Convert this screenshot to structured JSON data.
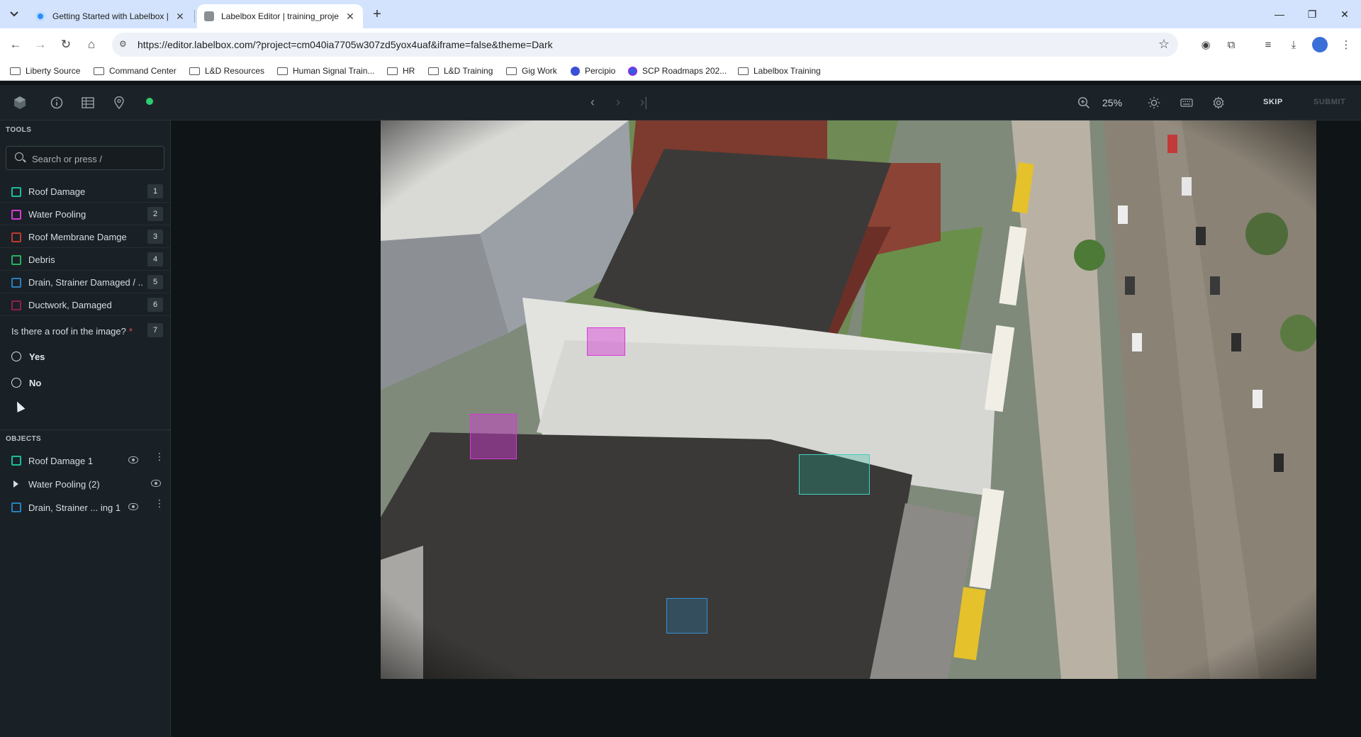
{
  "browser": {
    "tabs": [
      {
        "title": "Getting Started with Labelbox |",
        "active": false
      },
      {
        "title": "Labelbox Editor | training_proje",
        "active": true
      }
    ],
    "url": "https://editor.labelbox.com/?project=cm040ia7705w307zd5yox4uaf&iframe=false&theme=Dark",
    "bookmarks": [
      "Liberty Source",
      "Command Center",
      "L&D Resources",
      "Human Signal Train...",
      "HR",
      "L&D Training",
      "Gig Work",
      "Percipio",
      "SCP Roadmaps 202...",
      "Labelbox Training"
    ]
  },
  "header": {
    "zoom": "25%",
    "skip": "SKIP",
    "submit": "SUBMIT",
    "status_color": "#2ecc71"
  },
  "tools": {
    "section_title": "TOOLS",
    "search_placeholder": "Search or press /",
    "items": [
      {
        "label": "Roof Damage",
        "key": "1",
        "color": "#1abc9c"
      },
      {
        "label": "Water Pooling",
        "key": "2",
        "color": "#d63ad6"
      },
      {
        "label": "Roof Membrane Damge",
        "key": "3",
        "color": "#c0392b"
      },
      {
        "label": "Debris",
        "key": "4",
        "color": "#27ae60"
      },
      {
        "label": "Drain, Strainer Damaged / ...",
        "key": "5",
        "color": "#2980b9"
      },
      {
        "label": "Ductwork, Damaged",
        "key": "6",
        "color": "#8e1e4a"
      }
    ],
    "question": {
      "text": "Is there a roof in the image?",
      "required": "*",
      "key": "7",
      "options": [
        "Yes",
        "No"
      ]
    }
  },
  "objects": {
    "section_title": "OBJECTS",
    "items": [
      {
        "label": "Roof Damage 1",
        "color": "#1abc9c"
      },
      {
        "label": "Water Pooling (2)",
        "color": "#d63ad6"
      },
      {
        "label": "Drain, Strainer ... ing 1",
        "color": "#2980b9"
      }
    ]
  }
}
